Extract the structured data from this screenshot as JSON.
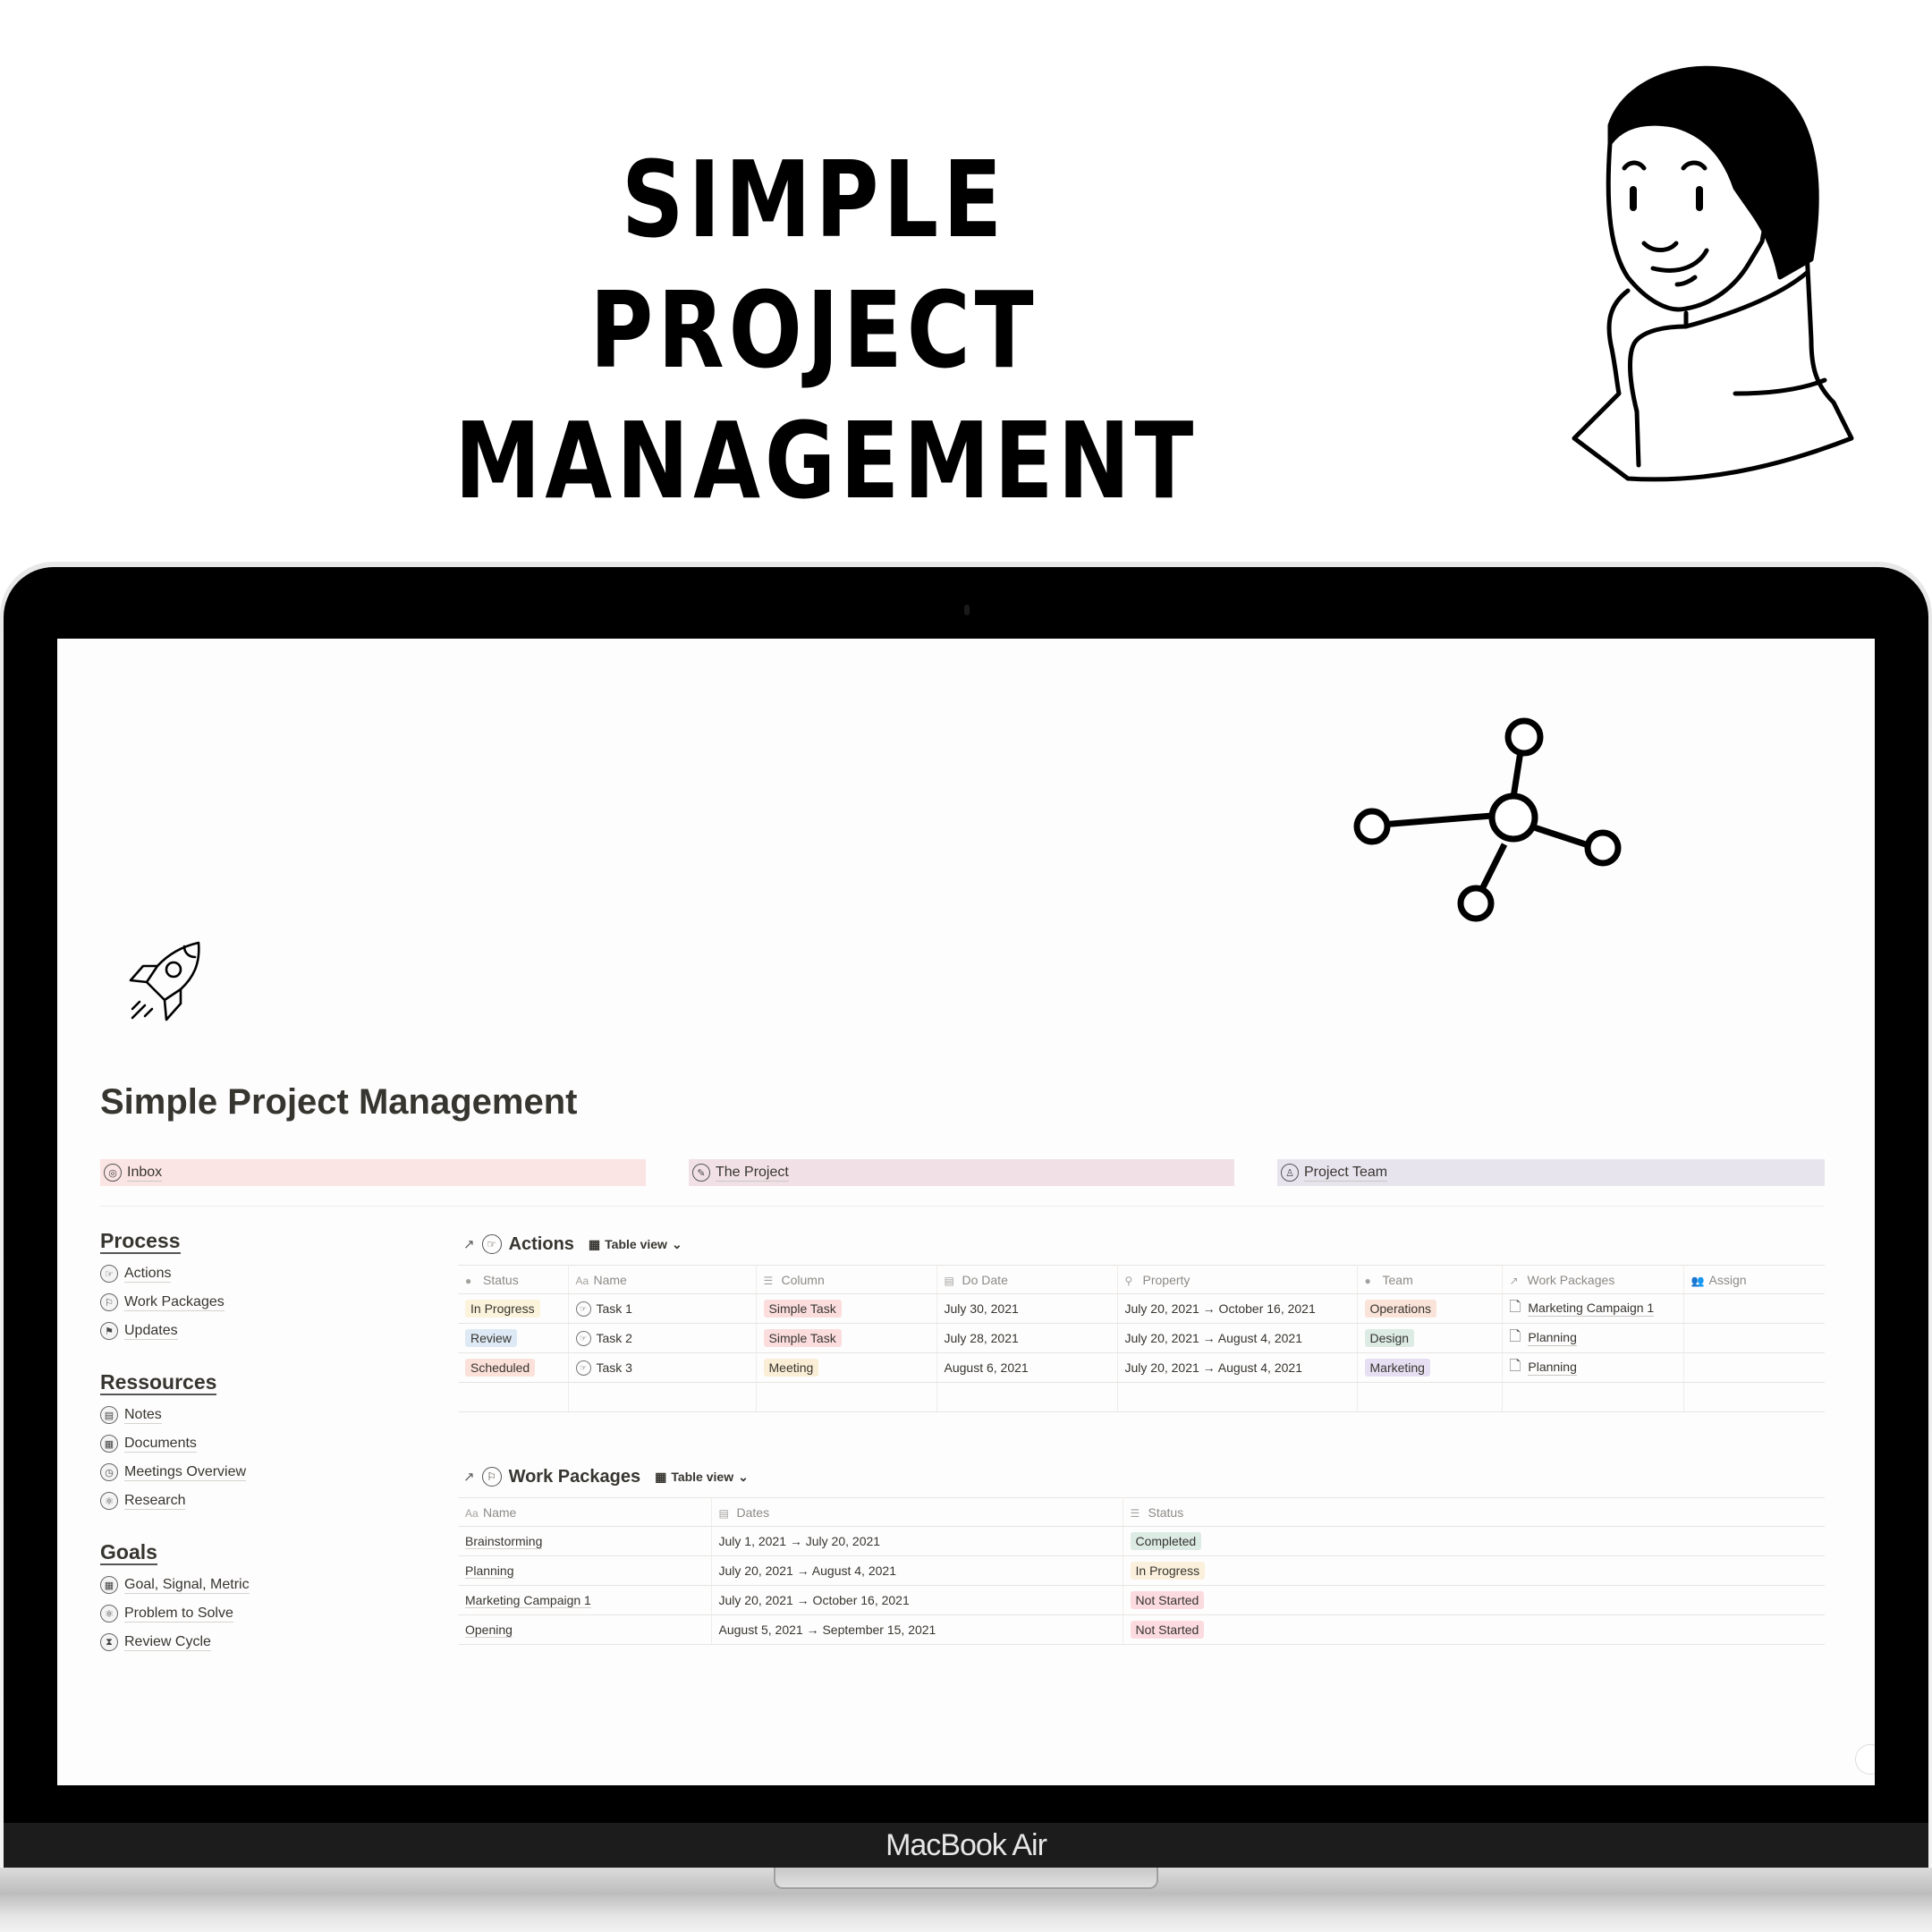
{
  "hero": {
    "title_line1": "SIMPLE PROJECT",
    "title_line2": "MANAGEMENT"
  },
  "device": {
    "brand_label": "MacBook Air"
  },
  "page": {
    "title": "Simple Project Management",
    "icon": "rocket-icon",
    "cover_icon": "network-icon"
  },
  "callouts": [
    {
      "label": "Inbox",
      "icon": "inbox-icon",
      "color": "#fbe4e4"
    },
    {
      "label": "The Project",
      "icon": "project-icon",
      "color": "#f1e1e6"
    },
    {
      "label": "Project Team",
      "icon": "team-icon",
      "color": "#e8e4ee"
    }
  ],
  "sidebar": {
    "sections": [
      {
        "title": "Process",
        "items": [
          {
            "label": "Actions",
            "icon": "pointing-hand-icon",
            "glyph": "☞"
          },
          {
            "label": "Work Packages",
            "icon": "flag-icon",
            "glyph": "⚐"
          },
          {
            "label": "Updates",
            "icon": "flag-filled-icon",
            "glyph": "⚑"
          }
        ]
      },
      {
        "title": "Ressources",
        "items": [
          {
            "label": "Notes",
            "icon": "book-icon",
            "glyph": "▤"
          },
          {
            "label": "Documents",
            "icon": "document-icon",
            "glyph": "▦"
          },
          {
            "label": "Meetings Overview",
            "icon": "clock-icon",
            "glyph": "◷"
          },
          {
            "label": "Research",
            "icon": "atom-icon",
            "glyph": "⚛"
          }
        ]
      },
      {
        "title": "Goals",
        "items": [
          {
            "label": "Goal, Signal, Metric",
            "icon": "document-icon",
            "glyph": "▦"
          },
          {
            "label": "Problem to Solve",
            "icon": "atom-icon",
            "glyph": "⚛"
          },
          {
            "label": "Review Cycle",
            "icon": "hourglass-icon",
            "glyph": "⧗"
          }
        ]
      }
    ]
  },
  "actions_db": {
    "title": "Actions",
    "view_label": "Table view",
    "columns": [
      {
        "label": "Status",
        "icon": "●"
      },
      {
        "label": "Name",
        "icon": "Aa"
      },
      {
        "label": "Column",
        "icon": "☰"
      },
      {
        "label": "Do Date",
        "icon": "▤"
      },
      {
        "label": "Property",
        "icon": "⚲"
      },
      {
        "label": "Team",
        "icon": "●"
      },
      {
        "label": "Work Packages",
        "icon": "↗"
      },
      {
        "label": "Assign",
        "icon": "👥"
      }
    ],
    "rows": [
      {
        "status": "In Progress",
        "status_color": "#fbf3db",
        "name": "Task 1",
        "column": "Simple Task",
        "column_color": "#fbdddd",
        "do_date": "July 30, 2021",
        "property": "July 20, 2021 → October 16, 2021",
        "team": "Operations",
        "team_color": "#fae3d8",
        "work_package": "Marketing Campaign 1",
        "assign": ""
      },
      {
        "status": "Review",
        "status_color": "#dde9f4",
        "name": "Task 2",
        "column": "Simple Task",
        "column_color": "#fbdddd",
        "do_date": "July 28, 2021",
        "property": "July 20, 2021 → August 4, 2021",
        "team": "Design",
        "team_color": "#dcebe4",
        "work_package": "Planning",
        "assign": ""
      },
      {
        "status": "Scheduled",
        "status_color": "#fbe1d9",
        "name": "Task 3",
        "column": "Meeting",
        "column_color": "#fbeed6",
        "do_date": "August 6, 2021",
        "property": "July 20, 2021 → August 4, 2021",
        "team": "Marketing",
        "team_color": "#e6dff3",
        "work_package": "Planning",
        "assign": ""
      }
    ]
  },
  "wp_db": {
    "title": "Work Packages",
    "view_label": "Table view",
    "columns": [
      {
        "label": "Name",
        "icon": "Aa"
      },
      {
        "label": "Dates",
        "icon": "▤"
      },
      {
        "label": "Status",
        "icon": "☰"
      }
    ],
    "rows": [
      {
        "name": "Brainstorming",
        "dates": "July 1, 2021 → July 20, 2021",
        "status": "Completed",
        "status_color": "#dcebe4"
      },
      {
        "name": "Planning",
        "dates": "July 20, 2021 → August 4, 2021",
        "status": "In Progress",
        "status_color": "#fbf0dc"
      },
      {
        "name": "Marketing Campaign 1",
        "dates": "July 20, 2021 → October 16, 2021",
        "status": "Not Started",
        "status_color": "#fcdbe0"
      },
      {
        "name": "Opening",
        "dates": "August 5, 2021 → September 15, 2021",
        "status": "Not Started",
        "status_color": "#fcdbe0"
      }
    ]
  }
}
